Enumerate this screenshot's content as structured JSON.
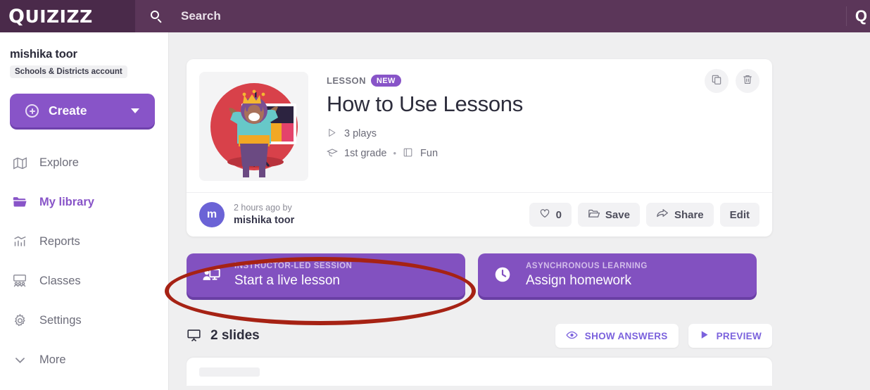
{
  "header": {
    "logo": "Quizizz",
    "search_placeholder": "Search",
    "search_icon": "search-icon",
    "right_glyph": "Q"
  },
  "sidebar": {
    "user_name": "mishika toor",
    "account_badge": "Schools & Districts account",
    "create_label": "Create",
    "create_icon": "plus-circle-icon",
    "create_chevron": "chevron-down-icon",
    "items": [
      {
        "label": "Explore",
        "icon": "compass-map-icon",
        "active": false
      },
      {
        "label": "My library",
        "icon": "folder-icon",
        "active": true
      },
      {
        "label": "Reports",
        "icon": "bar-chart-icon",
        "active": false
      },
      {
        "label": "Classes",
        "icon": "people-icon",
        "active": false
      },
      {
        "label": "Settings",
        "icon": "gear-icon",
        "active": false
      },
      {
        "label": "More",
        "icon": "chevron-down-icon",
        "active": false
      }
    ]
  },
  "lesson": {
    "kicker": "LESSON",
    "new_badge": "NEW",
    "title": "How to Use Lessons",
    "plays": "3 plays",
    "plays_icon": "play-outline-icon",
    "grade": "1st grade",
    "grade_icon": "graduation-cap-icon",
    "separator": "•",
    "subject": "Fun",
    "subject_icon": "book-icon",
    "duplicate_icon": "copy-icon",
    "delete_icon": "trash-icon",
    "avatar_initial": "m",
    "updated_when": "2 hours ago by",
    "author": "mishika toor",
    "actions": [
      {
        "label": "0",
        "icon": "heart-icon"
      },
      {
        "label": "Save",
        "icon": "folder-open-icon"
      },
      {
        "label": "Share",
        "icon": "share-arrow-icon"
      },
      {
        "label": "Edit",
        "icon": ""
      }
    ]
  },
  "modes": [
    {
      "kicker": "INSTRUCTOR-LED SESSION",
      "title": "Start a live lesson",
      "icon": "presenter-screen-icon"
    },
    {
      "kicker": "ASYNCHRONOUS LEARNING",
      "title": "Assign homework",
      "icon": "clock-icon"
    }
  ],
  "slides": {
    "count_label": "2 slides",
    "icon": "presentation-board-icon",
    "show_answers_label": "SHOW ANSWERS",
    "show_answers_icon": "eye-icon",
    "preview_label": "PREVIEW",
    "preview_icon": "play-icon"
  },
  "annotation": {
    "shape": "ellipse",
    "color": "#a62214",
    "targets": "Start a live lesson"
  },
  "colors": {
    "header_purple": "#4a2a4a",
    "brand_purple": "#8854c8",
    "mode_purple": "#8251c0",
    "accent_blue_purple": "#7b62dd",
    "annotation_red": "#a62214",
    "page_bg": "#efeff0"
  }
}
